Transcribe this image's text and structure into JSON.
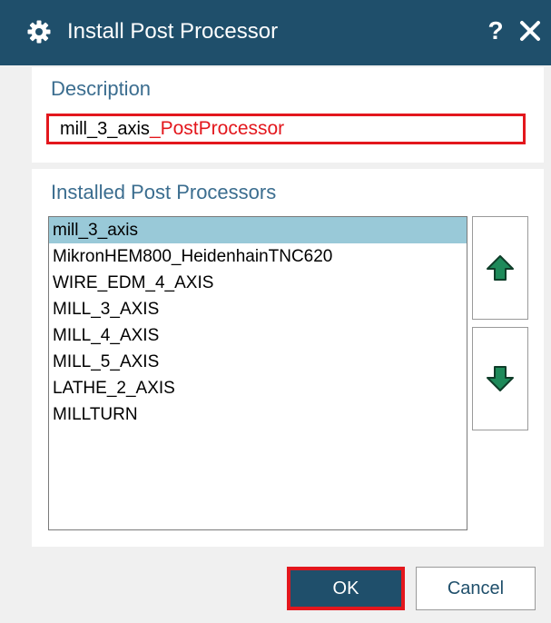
{
  "dialog": {
    "title": "Install Post Processor",
    "title_icon": "gear-icon",
    "help_label": "?",
    "close_icon": "close-icon"
  },
  "description": {
    "label": "Description",
    "value_base": "mill_3_axis",
    "value_suffix": "_PostProcessor"
  },
  "installed": {
    "label": "Installed Post Processors",
    "items": [
      {
        "label": "mill_3_axis",
        "selected": true
      },
      {
        "label": "MikronHEM800_HeidenhainTNC620",
        "selected": false
      },
      {
        "label": "WIRE_EDM_4_AXIS",
        "selected": false
      },
      {
        "label": "MILL_3_AXIS",
        "selected": false
      },
      {
        "label": "MILL_4_AXIS",
        "selected": false
      },
      {
        "label": "MILL_5_AXIS",
        "selected": false
      },
      {
        "label": "LATHE_2_AXIS",
        "selected": false
      },
      {
        "label": "MILLTURN",
        "selected": false
      }
    ],
    "move_up_icon": "arrow-up-icon",
    "move_down_icon": "arrow-down-icon"
  },
  "buttons": {
    "ok": "OK",
    "cancel": "Cancel"
  },
  "colors": {
    "titlebar": "#1f4f6b",
    "accent_text": "#3b6d8f",
    "highlight_red": "#e3171d",
    "selection": "#99c9d8",
    "arrow_green": "#1e8a5a"
  }
}
